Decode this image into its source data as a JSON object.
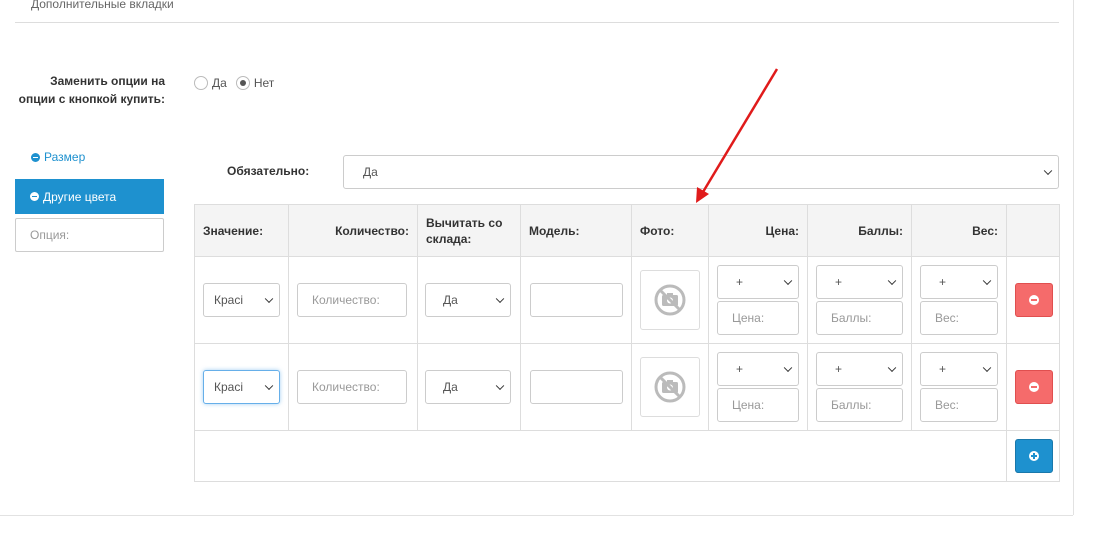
{
  "tabs": {
    "label": "Дополнительные вкладки"
  },
  "replace_option": {
    "label": "Заменить опции на опции с кнопкой купить:",
    "yes": "Да",
    "no": "Нет",
    "selected": "Нет"
  },
  "sidebar": {
    "items": [
      {
        "label": "Размер"
      },
      {
        "label": "Другие цвета"
      }
    ],
    "option_placeholder": "Опция:"
  },
  "required": {
    "label": "Обязательно:",
    "value": "Да"
  },
  "table": {
    "headers": {
      "value": "Значение:",
      "quantity": "Количество:",
      "subtract": "Вычитать со склада:",
      "model": "Модель:",
      "photo": "Фото:",
      "price": "Цена:",
      "points": "Баллы:",
      "weight": "Вес:"
    },
    "rows": [
      {
        "value": "Красі",
        "quantity_placeholder": "Количество:",
        "subtract": "Да",
        "model": "",
        "price_prefix": "+",
        "price_placeholder": "Цена:",
        "points_prefix": "+",
        "points_placeholder": "Баллы:",
        "weight_prefix": "+",
        "weight_placeholder": "Вес:"
      },
      {
        "value": "Красі",
        "quantity_placeholder": "Количество:",
        "subtract": "Да",
        "model": "",
        "price_prefix": "+",
        "price_placeholder": "Цена:",
        "points_prefix": "+",
        "points_placeholder": "Баллы:",
        "weight_prefix": "+",
        "weight_placeholder": "Вес:"
      }
    ]
  },
  "icons": {
    "photo": "no-photo-icon",
    "remove": "minus-circle-icon",
    "add": "plus-circle-icon"
  },
  "colors": {
    "primary": "#1e91cf",
    "danger": "#f56b6b",
    "arrow": "#e01b1b"
  }
}
